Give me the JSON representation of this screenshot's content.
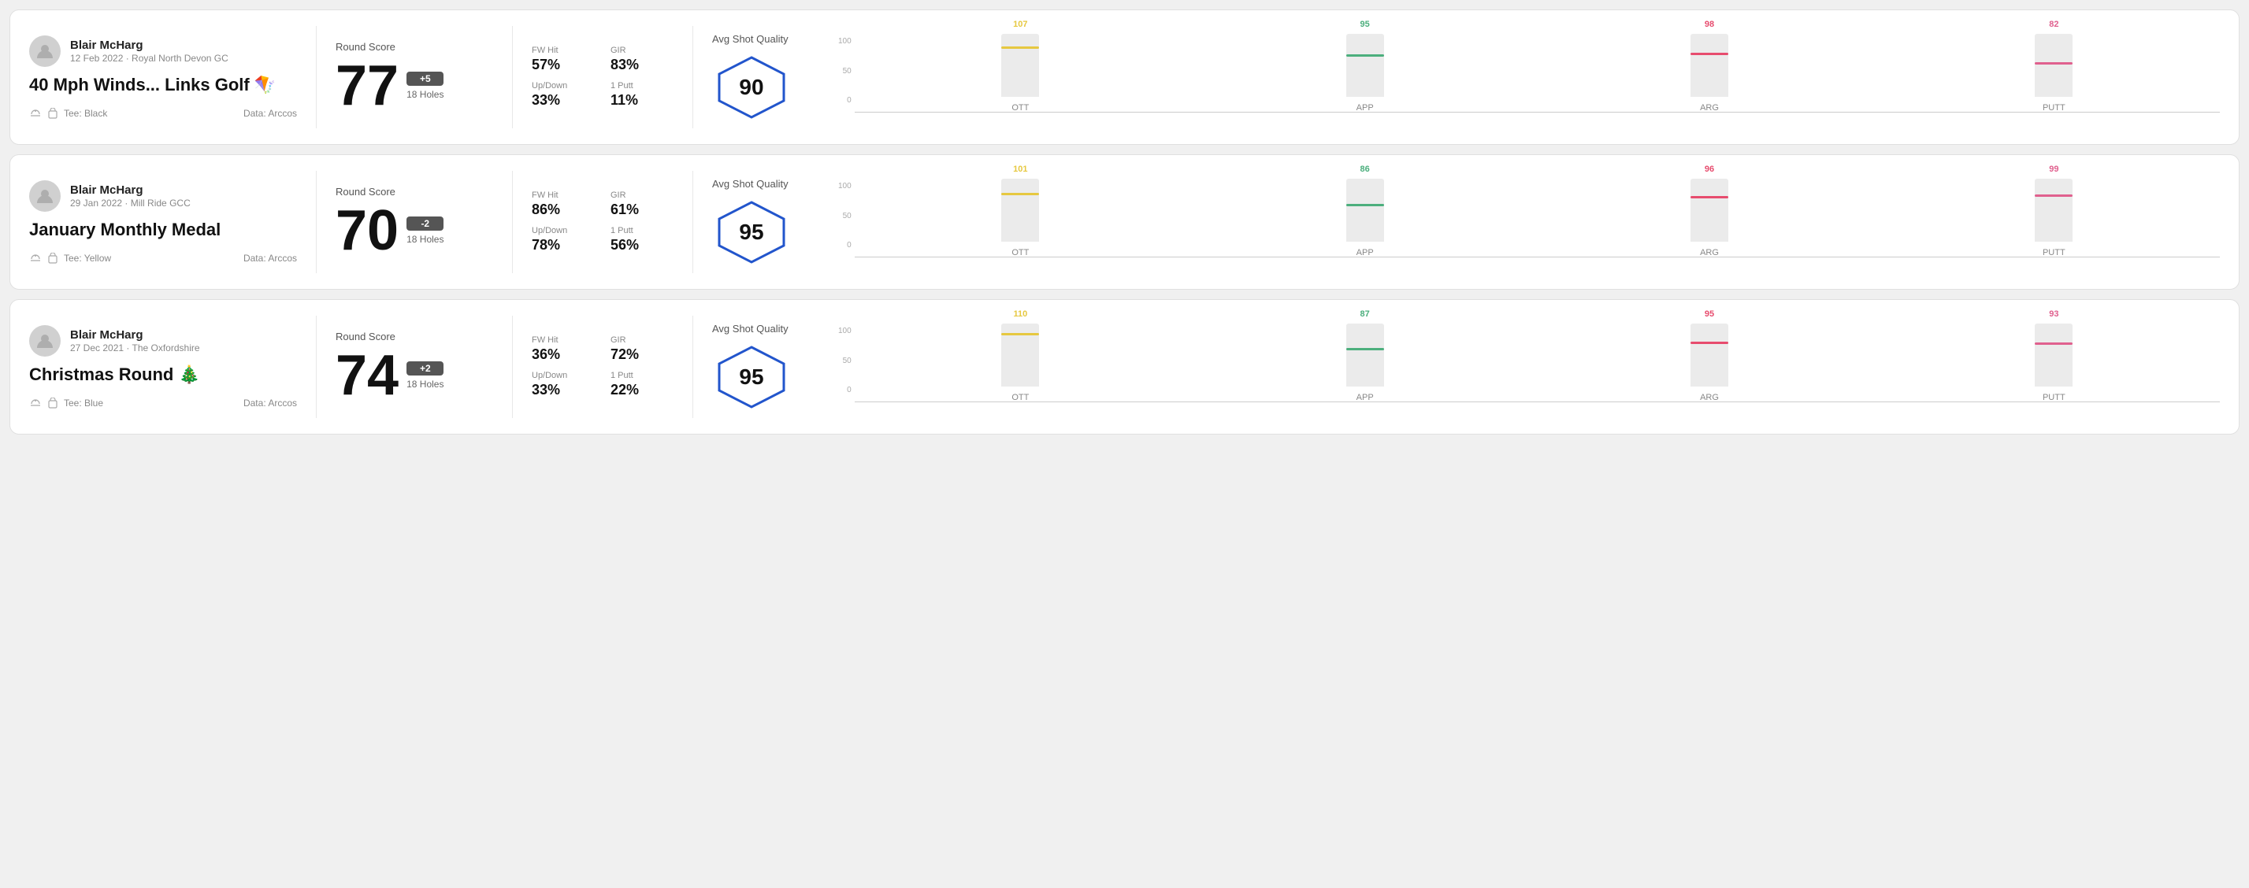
{
  "rounds": [
    {
      "id": "round1",
      "player": "Blair McHarg",
      "date": "12 Feb 2022 · Royal North Devon GC",
      "title": "40 Mph Winds... Links Golf",
      "title_emoji": "🪁",
      "tee": "Tee: Black",
      "data_source": "Data: Arccos",
      "score": "77",
      "score_diff": "+5",
      "holes": "18 Holes",
      "fw_hit": "57%",
      "gir": "83%",
      "up_down": "33%",
      "one_putt": "11%",
      "avg_quality": "90",
      "chart": {
        "bars": [
          {
            "label": "OTT",
            "value": 107,
            "color": "#e6c840",
            "pct": 80
          },
          {
            "label": "APP",
            "value": 95,
            "color": "#4caf7d",
            "pct": 67
          },
          {
            "label": "ARG",
            "value": 98,
            "color": "#e74c6e",
            "pct": 70
          },
          {
            "label": "PUTT",
            "value": 82,
            "color": "#e0608e",
            "pct": 55
          }
        ]
      }
    },
    {
      "id": "round2",
      "player": "Blair McHarg",
      "date": "29 Jan 2022 · Mill Ride GCC",
      "title": "January Monthly Medal",
      "title_emoji": "",
      "tee": "Tee: Yellow",
      "data_source": "Data: Arccos",
      "score": "70",
      "score_diff": "-2",
      "holes": "18 Holes",
      "fw_hit": "86%",
      "gir": "61%",
      "up_down": "78%",
      "one_putt": "56%",
      "avg_quality": "95",
      "chart": {
        "bars": [
          {
            "label": "OTT",
            "value": 101,
            "color": "#e6c840",
            "pct": 78
          },
          {
            "label": "APP",
            "value": 86,
            "color": "#4caf7d",
            "pct": 60
          },
          {
            "label": "ARG",
            "value": 96,
            "color": "#e74c6e",
            "pct": 72
          },
          {
            "label": "PUTT",
            "value": 99,
            "color": "#e0608e",
            "pct": 75
          }
        ]
      }
    },
    {
      "id": "round3",
      "player": "Blair McHarg",
      "date": "27 Dec 2021 · The Oxfordshire",
      "title": "Christmas Round",
      "title_emoji": "🎄",
      "tee": "Tee: Blue",
      "data_source": "Data: Arccos",
      "score": "74",
      "score_diff": "+2",
      "holes": "18 Holes",
      "fw_hit": "36%",
      "gir": "72%",
      "up_down": "33%",
      "one_putt": "22%",
      "avg_quality": "95",
      "chart": {
        "bars": [
          {
            "label": "OTT",
            "value": 110,
            "color": "#e6c840",
            "pct": 85
          },
          {
            "label": "APP",
            "value": 87,
            "color": "#4caf7d",
            "pct": 61
          },
          {
            "label": "ARG",
            "value": 95,
            "color": "#e74c6e",
            "pct": 71
          },
          {
            "label": "PUTT",
            "value": 93,
            "color": "#e0608e",
            "pct": 70
          }
        ]
      }
    }
  ],
  "labels": {
    "round_score": "Round Score",
    "fw_hit": "FW Hit",
    "gir": "GIR",
    "up_down": "Up/Down",
    "one_putt": "1 Putt",
    "avg_quality": "Avg Shot Quality",
    "chart_y_100": "100",
    "chart_y_50": "50",
    "chart_y_0": "0"
  }
}
